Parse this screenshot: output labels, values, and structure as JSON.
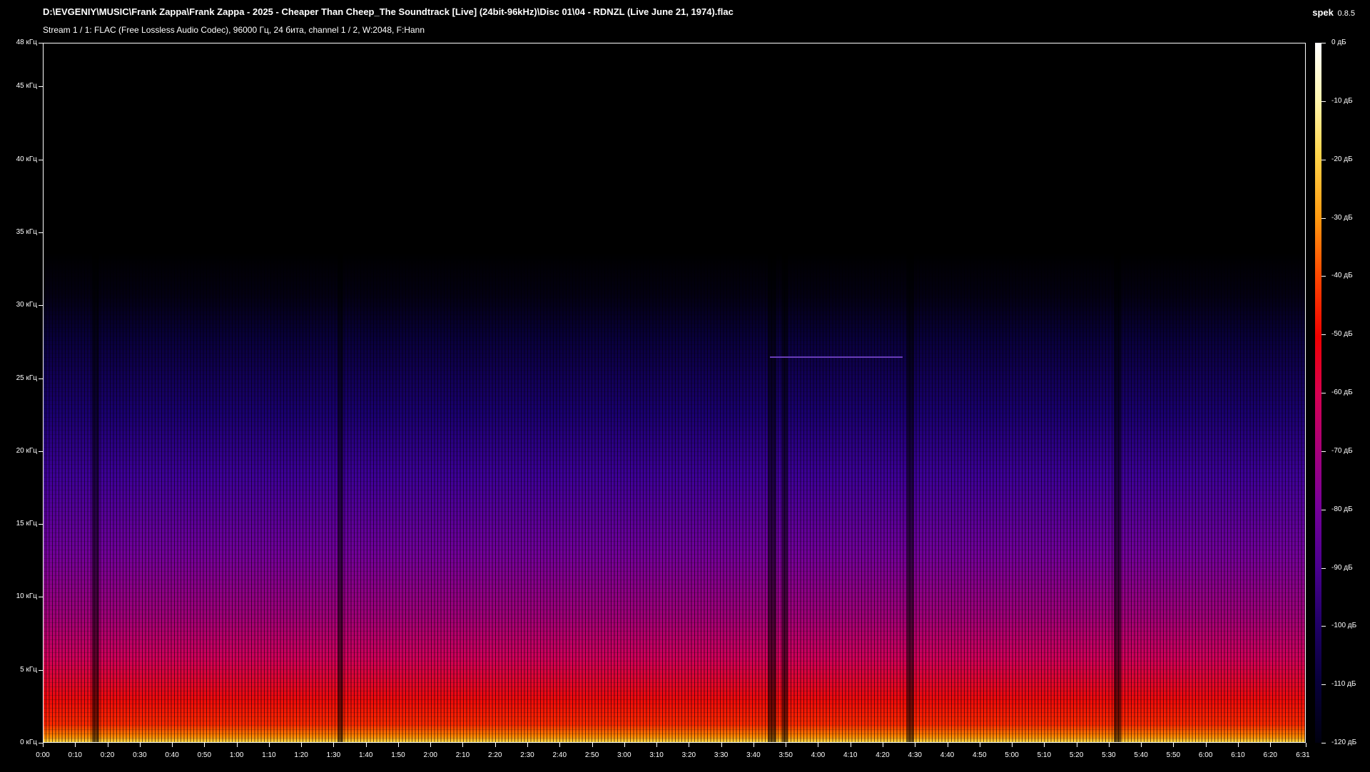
{
  "window": {
    "file_path": "D:\\EVGENIY\\MUSIC\\Frank Zappa\\Frank Zappa - 2025 - Cheaper Than Cheep_The Soundtrack [Live] (24bit-96kHz)\\Disc 01\\04 - RDNZL (Live June 21, 1974).flac",
    "stream_info": "Stream 1 / 1: FLAC (Free Lossless Audio Codec), 96000 Гц, 24 бита, channel 1 / 2, W:2048, F:Hann",
    "app_name": "spek",
    "app_version": "0.8.5"
  },
  "colors": {
    "background": "#000000",
    "text": "#ffffff",
    "palette_high": "#ffffff",
    "palette_mid": "#f00000",
    "palette_low": "#000010"
  },
  "frequency_axis": {
    "labels": [
      "48 кГц",
      "45 кГц",
      "40 кГц",
      "35 кГц",
      "30 кГц",
      "25 кГц",
      "20 кГц",
      "15 кГц",
      "10 кГц",
      "5 кГц",
      "0 кГц"
    ],
    "values_khz": [
      48,
      45,
      40,
      35,
      30,
      25,
      20,
      15,
      10,
      5,
      0
    ]
  },
  "time_axis": {
    "labels": [
      "0:00",
      "0:10",
      "0:20",
      "0:30",
      "0:40",
      "0:50",
      "1:00",
      "1:10",
      "1:20",
      "1:30",
      "1:40",
      "1:50",
      "2:00",
      "2:10",
      "2:20",
      "2:30",
      "2:40",
      "2:50",
      "3:00",
      "3:10",
      "3:20",
      "3:30",
      "3:40",
      "3:50",
      "4:00",
      "4:10",
      "4:20",
      "4:30",
      "4:40",
      "4:50",
      "5:00",
      "5:10",
      "5:20",
      "5:30",
      "5:40",
      "5:50",
      "6:00",
      "6:10",
      "6:20",
      "6:31"
    ],
    "values_s": [
      0,
      10,
      20,
      30,
      40,
      50,
      60,
      70,
      80,
      90,
      100,
      110,
      120,
      130,
      140,
      150,
      160,
      170,
      180,
      190,
      200,
      210,
      220,
      230,
      240,
      250,
      260,
      270,
      280,
      290,
      300,
      310,
      320,
      330,
      340,
      350,
      360,
      370,
      380,
      391
    ]
  },
  "db_scale": {
    "labels": [
      "0 дБ",
      "-10 дБ",
      "-20 дБ",
      "-30 дБ",
      "-40 дБ",
      "-50 дБ",
      "-60 дБ",
      "-70 дБ",
      "-80 дБ",
      "-90 дБ",
      "-100 дБ",
      "-110 дБ",
      "-120 дБ"
    ],
    "values_db": [
      0,
      -10,
      -20,
      -30,
      -40,
      -50,
      -60,
      -70,
      -80,
      -90,
      -100,
      -110,
      -120
    ]
  }
}
